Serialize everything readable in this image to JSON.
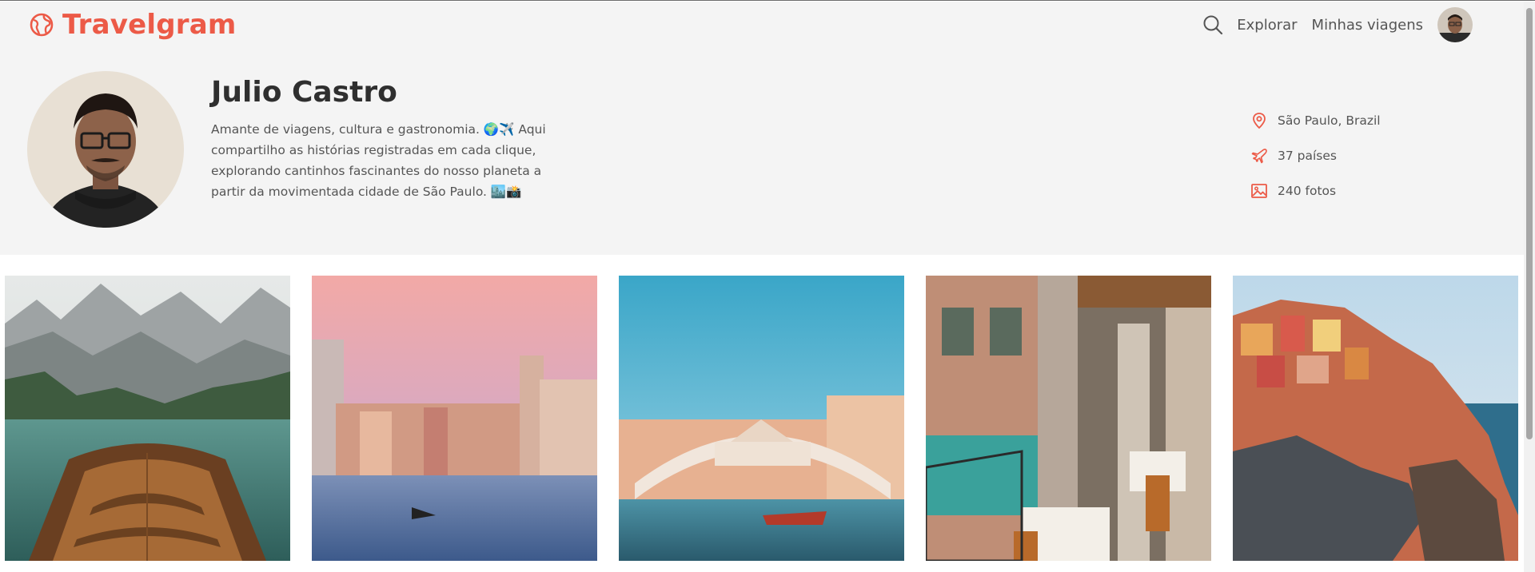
{
  "brand": {
    "name": "Travelgram",
    "color": "#ec5a47",
    "icon": "globe-icon"
  },
  "nav": {
    "search_icon": "search-icon",
    "links": [
      "Explorar",
      "Minhas viagens"
    ],
    "avatar": "user-avatar"
  },
  "profile": {
    "name": "Julio Castro",
    "bio": "Amante de viagens, cultura e gastronomia. 🌍✈️ Aqui compartilho as histórias registradas em cada clique, explorando cantinhos fascinantes do nosso planeta a partir da movimentada cidade de São Paulo. 🏙️📸",
    "stats": [
      {
        "icon": "map-pin-icon",
        "text": "São Paulo, Brazil"
      },
      {
        "icon": "plane-icon",
        "text": "37 países"
      },
      {
        "icon": "image-icon",
        "text": "240 fotos"
      }
    ]
  },
  "gallery": [
    {
      "subject": "boat on mountain lake"
    },
    {
      "subject": "Venice canal at sunset"
    },
    {
      "subject": "Rialto bridge Venice"
    },
    {
      "subject": "Venice canal-side restaurant"
    },
    {
      "subject": "colorful cliffside village"
    }
  ]
}
